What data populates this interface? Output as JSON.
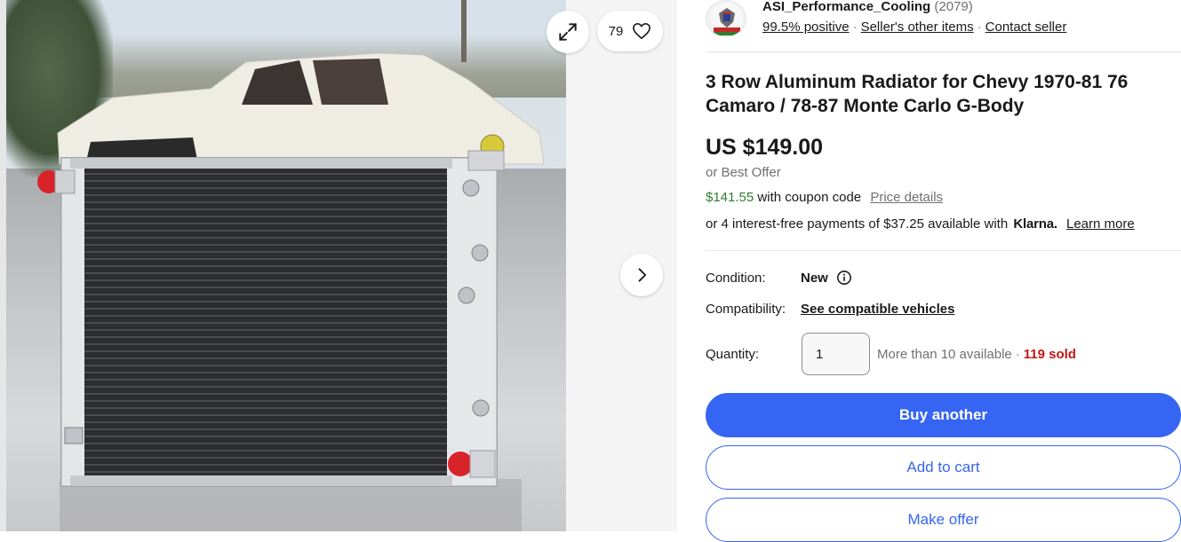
{
  "gallery": {
    "watch_count": "79",
    "icons": {
      "expand": "expand-arrows-icon",
      "watch": "heart-icon",
      "next": "chevron-right-icon"
    }
  },
  "seller": {
    "name": "ASI_Performance_Cooling",
    "feedback_count": "(2079)",
    "positive": "99.5% positive",
    "other_items": "Seller's other items",
    "contact": "Contact seller"
  },
  "listing": {
    "title": "3 Row Aluminum Radiator for Chevy 1970-81 76 Camaro / 78-87 Monte Carlo G-Body",
    "price": "US $149.00",
    "best_offer": "or Best Offer",
    "coupon_price": "$141.55",
    "coupon_text": "with coupon code",
    "price_details": "Price details",
    "klarna_text": "or 4 interest-free payments of $37.25 available with",
    "klarna_brand": "Klarna.",
    "learn_more": "Learn more"
  },
  "details": {
    "condition_label": "Condition:",
    "condition_value": "New",
    "compat_label": "Compatibility:",
    "compat_link": "See compatible vehicles",
    "quantity_label": "Quantity:",
    "quantity_value": "1",
    "available": "More than 10 available",
    "sold": "119 sold"
  },
  "actions": {
    "buy": "Buy another",
    "cart": "Add to cart",
    "offer": "Make offer"
  },
  "colors": {
    "primary": "#3665f3",
    "sold": "#c21616",
    "coupon": "#2f7d32"
  }
}
